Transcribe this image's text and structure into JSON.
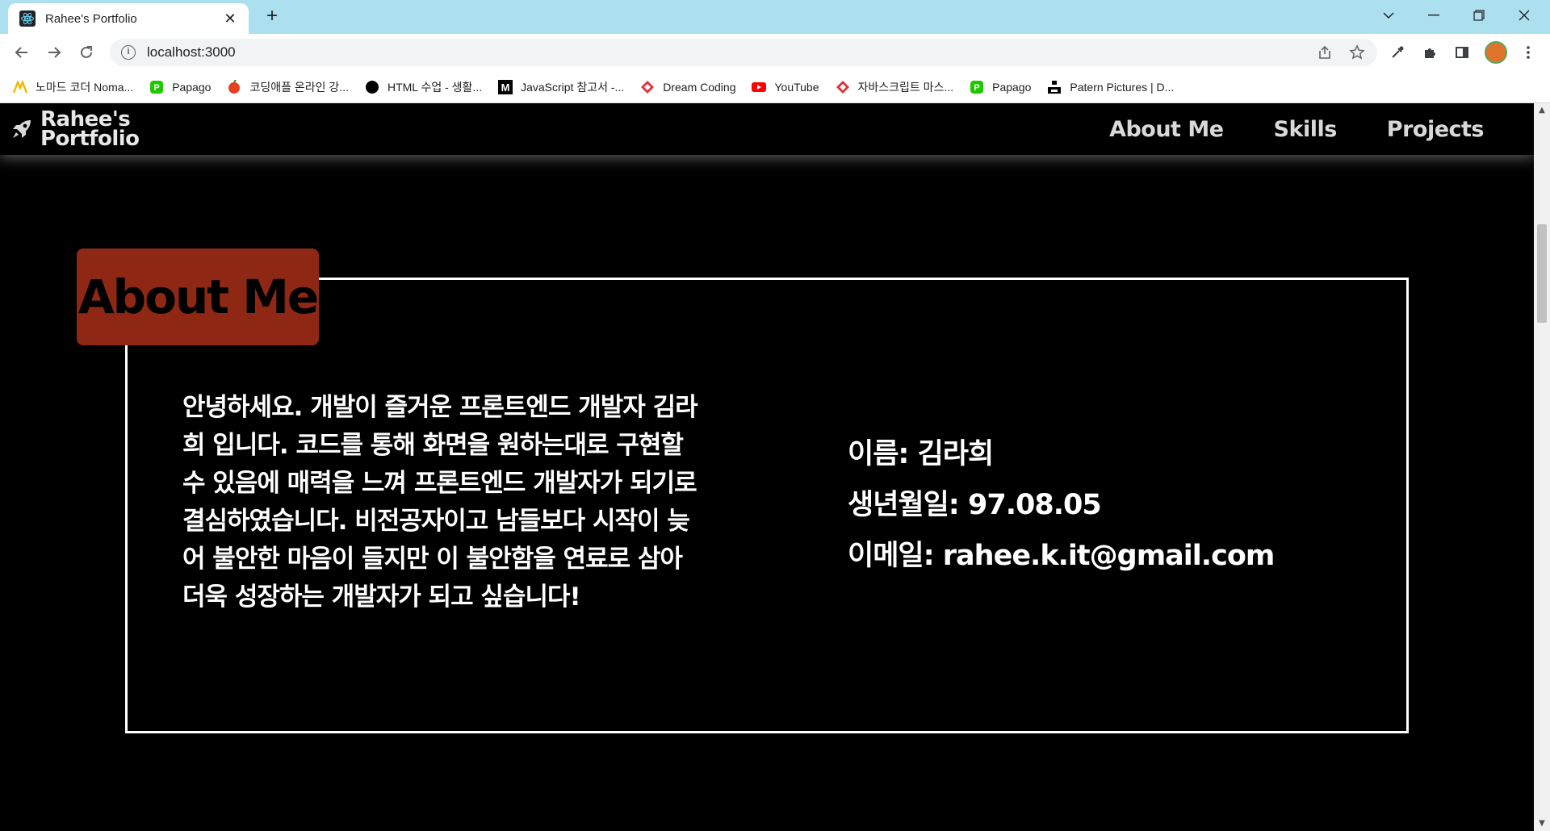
{
  "browser": {
    "tab_title": "Rahee's Portfolio",
    "url": "localhost:3000",
    "bookmarks": [
      {
        "label": "노마드 코더 Noma...",
        "icon": "nomad-coder-icon",
        "color": "#f7b500"
      },
      {
        "label": "Papago",
        "icon": "papago-icon",
        "color": "#1ec800"
      },
      {
        "label": "코딩애플 온라인 강...",
        "icon": "apple-icon",
        "color": "#e8401c"
      },
      {
        "label": "HTML 수업 - 생활...",
        "icon": "circle-icon",
        "color": "#000000"
      },
      {
        "label": "JavaScript 참고서 -...",
        "icon": "m-logo-icon",
        "color": "#000000"
      },
      {
        "label": "Dream Coding",
        "icon": "dream-coding-icon",
        "color": "#e0313b"
      },
      {
        "label": "YouTube",
        "icon": "youtube-icon",
        "color": "#ff0000"
      },
      {
        "label": "자바스크립트 마스...",
        "icon": "dream-coding-icon",
        "color": "#e0313b"
      },
      {
        "label": "Papago",
        "icon": "papago-icon",
        "color": "#1ec800"
      },
      {
        "label": "Patern Pictures | D...",
        "icon": "pattern-icon",
        "color": "#000000"
      }
    ]
  },
  "site": {
    "logo_line1": "Rahee's",
    "logo_line2": "Portfolio",
    "menu": [
      "About Me",
      "Skills",
      "Projects"
    ]
  },
  "about": {
    "heading": "About Me",
    "intro_lines": [
      "안녕하세요. 개발이 즐거운 프론트엔드 개발자 김라",
      "희 입니다. 코드를 통해 화면을 원하는대로 구현할",
      "수 있음에 매력을 느껴 프론트엔드 개발자가 되기로",
      "결심하였습니다. 비전공자이고 남들보다 시작이 늦",
      "어 불안한 마음이 들지만 이 불안함을 연료로 삼아",
      "더욱 성장하는 개발자가 되고 싶습니다!"
    ],
    "info": {
      "name": "이름: 김라희",
      "birth": "생년월일: 97.08.05",
      "email": "이메일: rahee.k.it@gmail.com"
    },
    "tag_color": "#8e2815"
  }
}
